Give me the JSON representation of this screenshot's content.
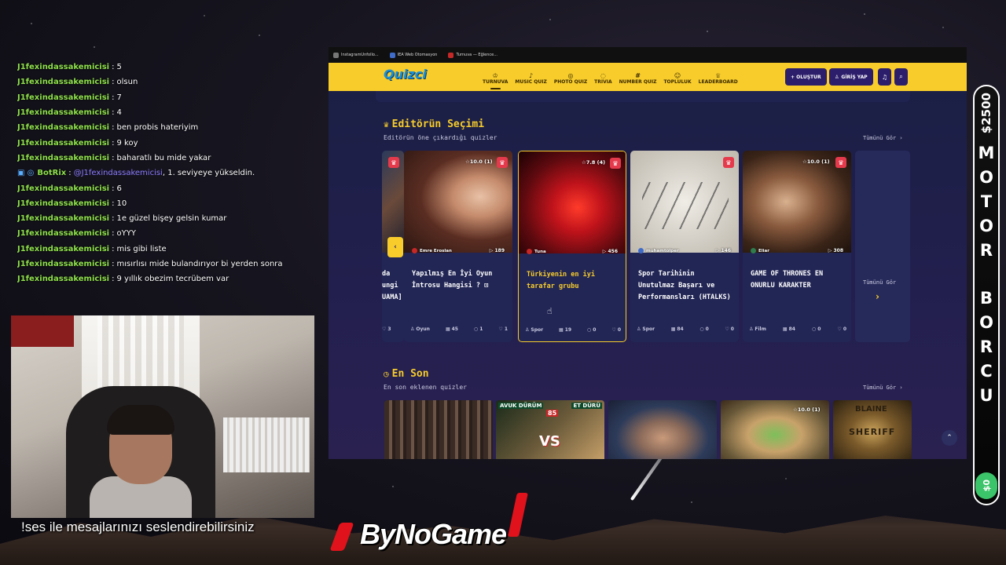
{
  "chat": {
    "messages": [
      {
        "user": "J1fexindassakemicisi",
        "text": "5"
      },
      {
        "user": "J1fexindassakemicisi",
        "text": "olsun"
      },
      {
        "user": "J1fexindassakemicisi",
        "text": "7"
      },
      {
        "user": "J1fexindassakemicisi",
        "text": "4"
      },
      {
        "user": "J1fexindassakemicisi",
        "text": "ben probis hateriyim"
      },
      {
        "user": "J1fexindassakemicisi",
        "text": "9 koy"
      },
      {
        "user": "J1fexindassakemicisi",
        "text": "baharatlı bu mide yakar"
      },
      {
        "user": "BotRix",
        "mention": "@J1fexindassakemicisi",
        "text": ", 1. seviyeye yükseldin."
      },
      {
        "user": "J1fexindassakemicisi",
        "text": "6"
      },
      {
        "user": "J1fexindassakemicisi",
        "text": "10"
      },
      {
        "user": "J1fexindassakemicisi",
        "text": "1e güzel bişey gelsin kumar"
      },
      {
        "user": "J1fexindassakemicisi",
        "text": "oYYY"
      },
      {
        "user": "J1fexindassakemicisi",
        "text": "mis gibi liste"
      },
      {
        "user": "J1fexindassakemicisi",
        "text": "mısırlısı mide bulandırıyor bi yerden sonra"
      },
      {
        "user": "J1fexindassakemicisi",
        "text": "9 yıllık obezim tecrübem var"
      }
    ]
  },
  "overlay": {
    "tts_text": "!ses ile mesajlarınızı seslendirebilirsiniz",
    "logo_text": "ByNoGame",
    "side_amount": "$2500",
    "side_letters_top": [
      "M",
      "O",
      "T",
      "O",
      "R"
    ],
    "side_letters_bottom": [
      "B",
      "O",
      "R",
      "C",
      "U"
    ],
    "side_bottom_amount": "$0"
  },
  "browser": {
    "tabs": [
      "InstagramUnfollo...",
      "IEA Web Otomasyon",
      "Turnuva — Eğlence..."
    ],
    "nav": {
      "logo": "Quizci",
      "items": [
        {
          "label": "TURNUVA",
          "icon": "trophy-icon",
          "glyph": "♔"
        },
        {
          "label": "MUSIC QUIZ",
          "icon": "music-icon",
          "glyph": "♪"
        },
        {
          "label": "PHOTO QUIZ",
          "icon": "camera-icon",
          "glyph": "◎"
        },
        {
          "label": "TRIVIA",
          "icon": "lightbulb-icon",
          "glyph": "◌"
        },
        {
          "label": "NUMBER QUIZ",
          "icon": "number-icon",
          "glyph": "#"
        },
        {
          "label": "TOPLULUK",
          "icon": "community-icon",
          "glyph": "☺"
        },
        {
          "label": "LEADERBOARD",
          "icon": "medal-icon",
          "glyph": "♕"
        }
      ],
      "create_label": "+ OLUŞTUR",
      "login_label": "GİRİŞ YAP"
    },
    "editors": {
      "title": "Editörün Seçimi",
      "subtitle": "Editörün öne çıkardığı quizler",
      "see_all": "Tümünü Gör ›",
      "partial_card": {
        "title_lines": [
          "da",
          "ungi",
          "UAMA]"
        ],
        "stats": "3"
      },
      "cards": [
        {
          "rating": "10.0 (1)",
          "author": "Emre Eroslan",
          "plays": "189",
          "title": "Yapılmış En İyi Oyun İntrosu Hangisi ? ⊡",
          "category": "Oyun",
          "questions": "45",
          "comments": "1",
          "likes": "1"
        },
        {
          "rating": "7.8 (4)",
          "author": "Tuna",
          "plays": "456",
          "title": "Türkiyenin en iyi tarafar grubu",
          "category": "Spor",
          "questions": "19",
          "comments": "0",
          "likes": "0"
        },
        {
          "rating": "",
          "author": "muhamtolper",
          "plays": "146",
          "title": "Spor Tarihinin Unutulmaz Başarı ve Performansları (HTALKS)",
          "category": "Spor",
          "questions": "84",
          "comments": "0",
          "likes": "0"
        },
        {
          "rating": "10.0 (1)",
          "author": "Eliar",
          "plays": "308",
          "title": "GAME OF THRONES EN ONURLU KARAKTER",
          "category": "Film",
          "questions": "84",
          "comments": "0",
          "likes": "0"
        }
      ],
      "ghost_see_all": "Tümünü Gör"
    },
    "latest": {
      "title": "En Son",
      "subtitle": "En son eklenen quizler",
      "see_all": "Tümünü Gör ›",
      "thumbs": [
        {
          "labels": []
        },
        {
          "left": "AVUK DÜRÜM",
          "right": "ET DÜRÜ",
          "score": "85",
          "vs": "VS"
        },
        {
          "labels": []
        },
        {
          "rating": "10.0 (1)"
        },
        {
          "top": "BLAINE",
          "mid": "SHERIFF"
        }
      ]
    }
  },
  "colors": {
    "accent": "#f7cc2b",
    "nav_button": "#2c1e6b",
    "page_bg": "#1b1f45",
    "chat_user": "#8ee04b",
    "crown": "#e53a4c"
  }
}
